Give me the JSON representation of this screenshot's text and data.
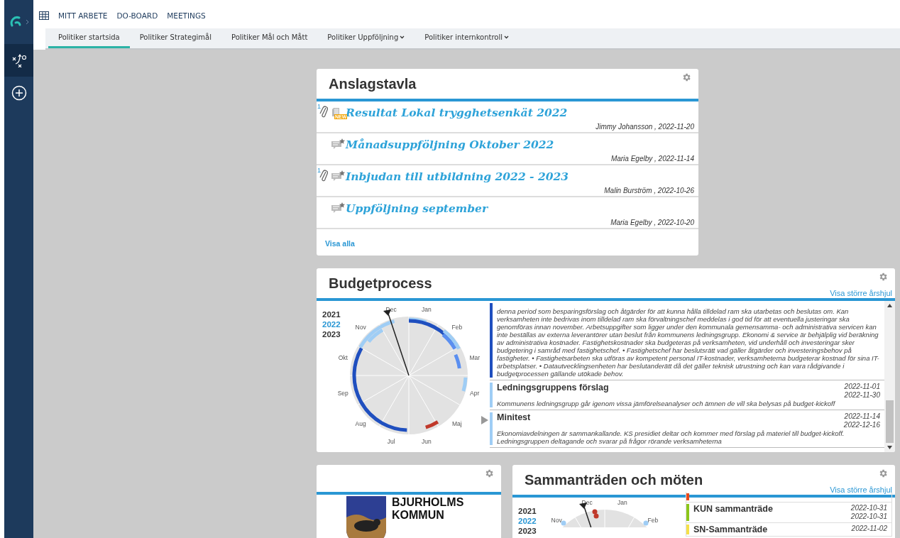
{
  "sidebar": {
    "items": [
      {
        "kind": "tactics",
        "selected": true
      },
      {
        "kind": "add",
        "selected": false
      }
    ]
  },
  "top_nav": {
    "links": [
      "MITT ARBETE",
      "DO-BOARD",
      "MEETINGS"
    ]
  },
  "tabs": [
    {
      "label": "Politiker startsida",
      "selected": true,
      "has_menu": false
    },
    {
      "label": "Politiker Strategimål",
      "selected": false,
      "has_menu": false
    },
    {
      "label": "Politiker Mål och Mått",
      "selected": false,
      "has_menu": false
    },
    {
      "label": "Politiker Uppföljning",
      "selected": false,
      "has_menu": true
    },
    {
      "label": "Politiker internkontroll",
      "selected": false,
      "has_menu": true
    }
  ],
  "notice_board": {
    "title": "Anslagstavla",
    "items": [
      {
        "kind": "new",
        "attachments": "1",
        "badge": "NEW",
        "title": "Resultat Lokal trygghetsenkät 2022",
        "byline": "Jimmy Johansson , 2022-11-20"
      },
      {
        "kind": "message",
        "title": "Månadsuppföljning Oktober 2022",
        "byline": "Maria Egelby , 2022-11-14"
      },
      {
        "kind": "message",
        "attachments": "1",
        "title": "Inbjudan till utbildning 2022 - 2023",
        "byline": "Malin Burström , 2022-10-26"
      },
      {
        "kind": "message",
        "title": "Uppföljning september",
        "byline": "Maria Egelby , 2022-10-20"
      }
    ],
    "footer_link": "Visa alla"
  },
  "budget": {
    "title": "Budgetprocess",
    "link": "Visa större årshjul",
    "years": [
      {
        "label": "2021",
        "selected": false
      },
      {
        "label": "2022",
        "selected": true
      },
      {
        "label": "2023",
        "selected": false
      }
    ],
    "months": [
      "Jan",
      "Feb",
      "Mar",
      "Apr",
      "Maj",
      "Jun",
      "Jul",
      "Aug",
      "Sep",
      "Okt",
      "Nov",
      "Dec"
    ],
    "events": [
      {
        "color": "#1f4fbf",
        "description": "denna period som besparingsförslag och åtgärder för att kunna hålla tilldelad ram ska utarbetas och beslutas om. Kan verksamheten inte bedrivas inom tilldelad ram ska förvaltningschef meddelas i god tid för att eventuella justeringar ska genomföras innan november. Arbetsuppgifter som ligger under den kommunala gemensamma- och administrativa servicen kan inte beställas av externa leverantörer utan beslut från kommunens ledningsgrupp. Ekonomi & service är behjälplig vid beräkning av administrativa kostnader. Fastighetskostnader ska budgeteras på verksamheten, vid underhåll och investeringar sker budgetering i samråd med fastighetschef. • Fastighetschef har beslutsrätt vad gäller åtgärder och investeringsbehov på fastigheter. • Fastighetsarbeten ska utföras av kompetent personal IT-kostnader, verksamheterna budgeterar kostnad för sina IT-arbetsplatser. • Datautvecklingsenheten har beslutanderätt då det gäller teknisk utrustning och kan vara rådgivande i budgetprocessen gällande utökade behov."
      },
      {
        "color": "#9fcdf5",
        "title": "Ledningsgruppens förslag",
        "start": "2022-11-01",
        "end": "2022-11-30",
        "description": "Kommunens ledningsgrupp går igenom vissa jämförelseanalyser och ämnen de vill ska belysas på budget-kickoff"
      },
      {
        "color": "#9fcdf5",
        "title": "Minitest",
        "start": "2022-11-14",
        "end": "2022-12-16",
        "description": "Ekonomiavdelningen är sammankallande. KS presidiet deltar och kommer med förslag på materiel till budget-kickoff. Ledningsgruppen deltagande och svarar på frågor rörande verksamheterna"
      }
    ]
  },
  "logo_card": {
    "name": "BJURHOLMS KOMMUN"
  },
  "meetings": {
    "title": "Sammanträden och möten",
    "link": "Visa större årshjul",
    "years": [
      {
        "label": "2021",
        "selected": false
      },
      {
        "label": "2022",
        "selected": true
      },
      {
        "label": "2023",
        "selected": false
      }
    ],
    "months": [
      "Nov",
      "Dec",
      "Jan",
      "Feb"
    ],
    "events": [
      {
        "color": "#e84a1c"
      },
      {
        "color": "#8cc61a",
        "title": "KUN sammanträde",
        "start": "2022-10-31",
        "end": "2022-10-31"
      },
      {
        "color": "#f5e14a",
        "title": "SN-Sammanträde",
        "start": "2022-11-02"
      }
    ]
  }
}
